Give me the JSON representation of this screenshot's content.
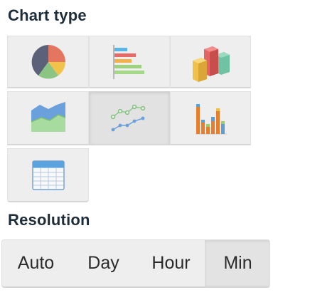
{
  "chart_type": {
    "title": "Chart type",
    "options": [
      {
        "icon": "pie-chart-icon",
        "selected": false
      },
      {
        "icon": "bar-chart-horizontal-icon",
        "selected": false
      },
      {
        "icon": "bar-chart-3d-icon",
        "selected": false
      },
      {
        "icon": "area-chart-icon",
        "selected": false
      },
      {
        "icon": "line-chart-icon",
        "selected": true
      },
      {
        "icon": "stacked-column-chart-icon",
        "selected": false
      },
      {
        "icon": "table-icon",
        "selected": false
      }
    ]
  },
  "resolution": {
    "title": "Resolution",
    "options": [
      "Auto",
      "Day",
      "Hour",
      "Min"
    ],
    "selected": "Min"
  },
  "colors": {
    "title": "#1d2d3a",
    "tile_bg": "#eeeeee",
    "tile_active_bg": "#e2e2e2"
  }
}
